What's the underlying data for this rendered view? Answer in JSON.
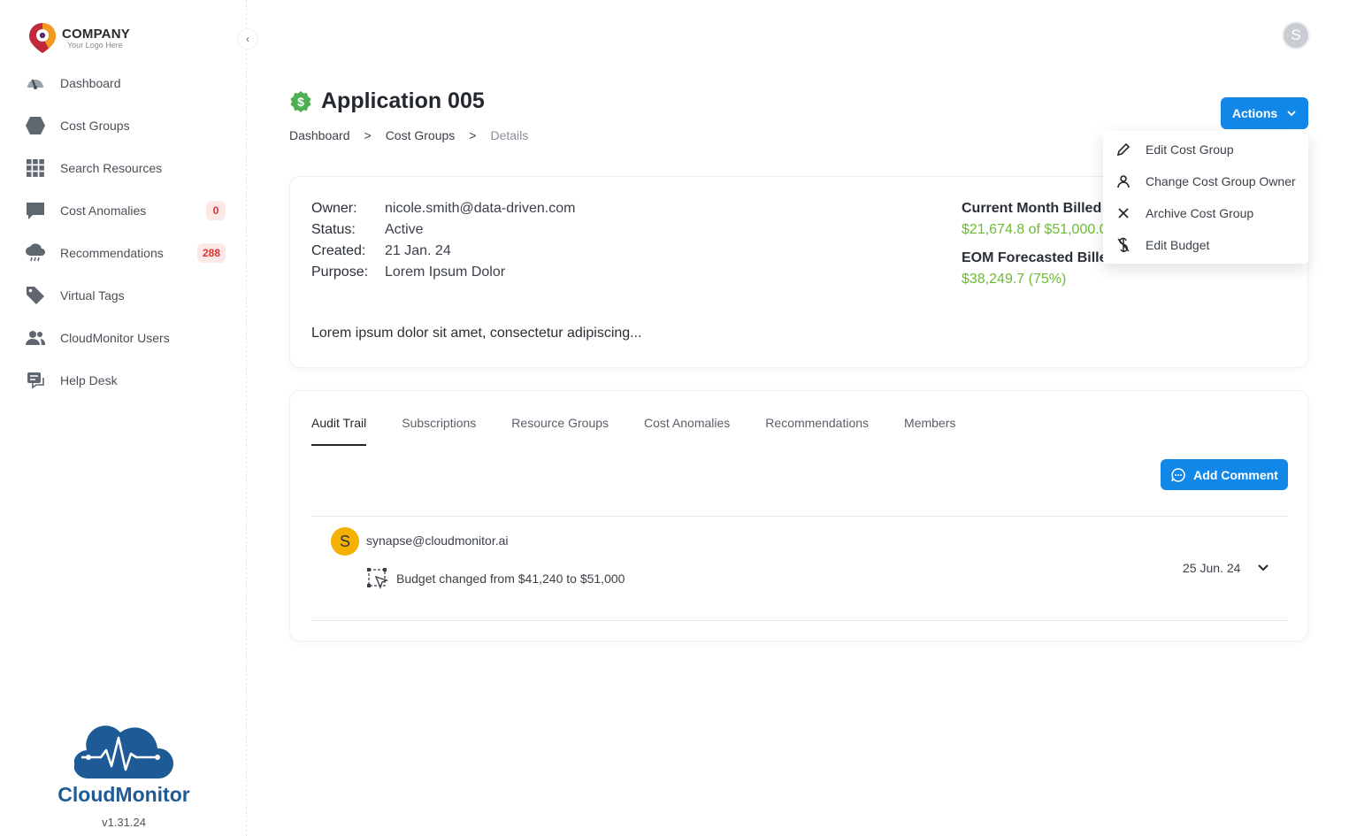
{
  "brand": {
    "company": "COMPANY",
    "tagline": "Your Logo Here",
    "product": "CloudMonitor",
    "version": "v1.31.24"
  },
  "sidebar": {
    "items": [
      {
        "label": "Dashboard",
        "icon": "dashboard-gauge-icon"
      },
      {
        "label": "Cost Groups",
        "icon": "hexagon-icon"
      },
      {
        "label": "Search Resources",
        "icon": "grid-icon"
      },
      {
        "label": "Cost Anomalies",
        "icon": "chat-bubble-icon",
        "badge": "0"
      },
      {
        "label": "Recommendations",
        "icon": "cloud-rain-icon",
        "badge": "288"
      },
      {
        "label": "Virtual Tags",
        "icon": "tag-icon"
      },
      {
        "label": "CloudMonitor Users",
        "icon": "users-icon"
      },
      {
        "label": "Help Desk",
        "icon": "help-desk-icon"
      }
    ]
  },
  "user": {
    "avatar_initial": "S"
  },
  "page": {
    "title": "Application 005",
    "breadcrumb": [
      "Dashboard",
      ">",
      "Cost Groups",
      ">",
      "Details"
    ]
  },
  "actions": {
    "label": "Actions",
    "menu": [
      {
        "label": "Edit Cost Group",
        "icon": "pencil-icon"
      },
      {
        "label": "Change Cost Group Owner",
        "icon": "person-icon"
      },
      {
        "label": "Archive Cost Group",
        "icon": "close-icon"
      },
      {
        "label": "Edit Budget",
        "icon": "dollar-off-icon"
      }
    ]
  },
  "details": {
    "owner_label": "Owner:",
    "owner": "nicole.smith@data-driven.com",
    "status_label": "Status:",
    "status": "Active",
    "created_label": "Created:",
    "created": "21 Jan. 24",
    "purpose_label": "Purpose:",
    "purpose": "Lorem Ipsum Dolor",
    "description": "Lorem ipsum dolor sit amet, consectetur adipiscing...",
    "current_billed_label": "Current Month Billed",
    "current_billed_value": "$21,674.8 of $51,000.0",
    "eom_label": "EOM Forecasted Billed",
    "eom_value": "$38,249.7 (75%)"
  },
  "tabs": [
    {
      "label": "Audit Trail",
      "active": true
    },
    {
      "label": "Subscriptions",
      "active": false
    },
    {
      "label": "Resource Groups",
      "active": false
    },
    {
      "label": "Cost Anomalies",
      "active": false
    },
    {
      "label": "Recommendations",
      "active": false
    },
    {
      "label": "Members",
      "active": false
    }
  ],
  "audit": {
    "add_comment_label": "Add Comment",
    "entries": [
      {
        "initial": "S",
        "user": "synapse@cloudmonitor.ai",
        "text": "Budget changed from $41,240 to $51,000",
        "date": "25 Jun. 24"
      }
    ]
  },
  "colors": {
    "primary": "#1188e8",
    "success": "#6cbb34",
    "badge_bg": "#fde8e8",
    "badge_text": "#d9352c",
    "brand_blue": "#1e5a95",
    "comment_avatar": "#f5b100"
  }
}
